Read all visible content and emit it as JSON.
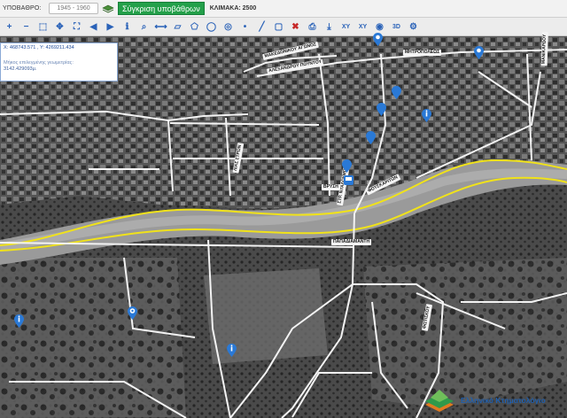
{
  "topbar": {
    "photo_label": "ΥΠΟΒΑΘΡΟ:",
    "year_select": "1945 - 1960",
    "compare_button": "Σύγκριση υποβάθρων",
    "scale_label": "ΚΛΙΜΑΚΑ: 2500"
  },
  "toolbar": {
    "tools": [
      {
        "name": "zoom-in-icon",
        "glyph": "+"
      },
      {
        "name": "zoom-out-icon",
        "glyph": "−"
      },
      {
        "name": "zoom-box-icon",
        "glyph": "⬚"
      },
      {
        "name": "pan-icon",
        "glyph": "✥"
      },
      {
        "name": "full-extent-icon",
        "glyph": "⛶"
      },
      {
        "name": "previous-extent-icon",
        "glyph": "◀"
      },
      {
        "name": "next-extent-icon",
        "glyph": "▶"
      },
      {
        "name": "identify-icon",
        "glyph": "ℹ"
      },
      {
        "name": "search-icon",
        "glyph": "⌕"
      },
      {
        "name": "measure-line-icon",
        "glyph": "⟷"
      },
      {
        "name": "measure-area-icon",
        "glyph": "▱"
      },
      {
        "name": "polygon-icon",
        "glyph": "⬠"
      },
      {
        "name": "circle-icon",
        "glyph": "◯"
      },
      {
        "name": "target-icon",
        "glyph": "◎"
      },
      {
        "name": "draw-point-icon",
        "glyph": "•"
      },
      {
        "name": "draw-line-icon",
        "glyph": "╱"
      },
      {
        "name": "draw-box-icon",
        "glyph": "▢"
      },
      {
        "name": "delete-icon",
        "glyph": "✖"
      },
      {
        "name": "print-icon",
        "glyph": "⎙"
      },
      {
        "name": "export-icon",
        "glyph": "⤓"
      },
      {
        "name": "coordinates-icon",
        "glyph": "XY"
      },
      {
        "name": "goto-xy-icon",
        "glyph": "XY"
      },
      {
        "name": "street-view-icon",
        "glyph": "◉"
      },
      {
        "name": "3d-view-icon",
        "glyph": "3D"
      },
      {
        "name": "settings-icon",
        "glyph": "⚙"
      }
    ]
  },
  "info_panel": {
    "coords": "X: 468743.571 , Y: 4269211.434",
    "length_label": "Μήκος επιλεγμένης γεωμετρίας:",
    "length_value": "3142.429093μ."
  },
  "streets": [
    "ΜΗΤΡΟΠΟΛΕΩΣ",
    "ΜΑΚΕΔΟΝΙΚΟΥ ΑΓΩΝΟΣ",
    "ΑΛΕΞΑΝΔΡΟΥ ΠΟΥΝΤΟΥ",
    "ΛΙΑΣ ΣΤΡΩΝ",
    "ΣΤΡ. ΝΤΑΛΟΥΜΠΑ",
    "ΒΡΥΣΗ",
    "ΦΟΥΣΚΑΡΙΤΩΝ",
    "ΠΑΠΑΔΙΑΜΑΝΤΗ",
    "ΜΑΝΙΚΑΡΔΟΥ",
    "ΦΩΤΙΣΚΟΥ"
  ],
  "logo": {
    "text": "Ελληνικό Κτηματολόγιο"
  },
  "colors": {
    "accent_green": "#24a04a",
    "route_yellow": "#f0e21a",
    "marker_blue": "#2a79d6",
    "logo_blue": "#1f5fae"
  }
}
